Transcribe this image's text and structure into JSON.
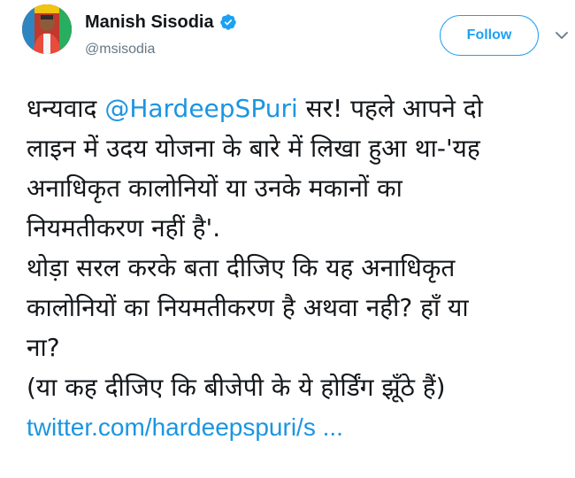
{
  "tweet": {
    "author": {
      "display_name": "Manish Sisodia",
      "handle": "@msisodia",
      "verified_icon": "verified-badge-icon"
    },
    "follow_label": "Follow",
    "caret_icon": "chevron-down-icon",
    "accent_color": "#1da1f2",
    "link_color": "#1b95e0",
    "text": {
      "line1_pre": "धन्यवाद ",
      "mention": "@HardeepSPuri",
      "line1_post": " सर! पहले आपने दो",
      "line2": "लाइन में उदय योजना के बारे में लिखा हुआ था-'यह",
      "line3": "अनाधिकृत कालोनियों या उनके मकानों का",
      "line4": "नियमतीकरण नहीं है'.",
      "line5": "थोड़ा सरल करके बता दीजिए कि यह अनाधिकृत",
      "line6": "कालोनियों का नियमतीकरण है अथवा नही? हाँ या",
      "line7": "ना?",
      "line8": "(या कह दीजिए कि बीजेपी के ये होर्डिंग झूँठे हैं)",
      "link": "twitter.com/hardeepspuri/s ..."
    }
  }
}
